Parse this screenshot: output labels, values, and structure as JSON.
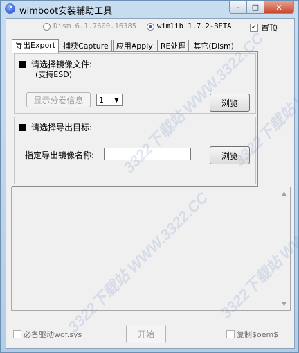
{
  "window": {
    "title": "wimboot安装辅助工具",
    "controls": {
      "minimize": "–",
      "maximize": "□",
      "close": "✕"
    }
  },
  "mode": {
    "dism_label": "Dism 6.1.7600.16385",
    "dism_selected": false,
    "wimlib_label": "wimlib 1.7.2-BETA",
    "wimlib_selected": true,
    "pin_label": "置顶",
    "pin_checked": true
  },
  "tabs": [
    {
      "label": "导出Export",
      "active": true
    },
    {
      "label": "捕获Capture",
      "active": false
    },
    {
      "label": "应用Apply",
      "active": false
    },
    {
      "label": "RE处理",
      "active": false
    },
    {
      "label": "其它(Dism)",
      "active": false
    }
  ],
  "source": {
    "title": "请选择镜像文件:",
    "subtitle": "(支持ESD)",
    "show_volume_button": "显示分卷信息",
    "volume_value": "1",
    "browse_button": "浏览"
  },
  "target": {
    "title": "请选择导出目标:",
    "name_label": "指定导出镜像名称:",
    "name_value": "",
    "browse_button": "浏览"
  },
  "footer": {
    "driver_checkbox_label": "必备驱动wof.sys",
    "driver_checked": false,
    "start_button": "开始",
    "copy_oem_label": "复制$oem$",
    "copy_oem_checked": false
  },
  "watermark": "3322下载站 WWW.3322.CC"
}
